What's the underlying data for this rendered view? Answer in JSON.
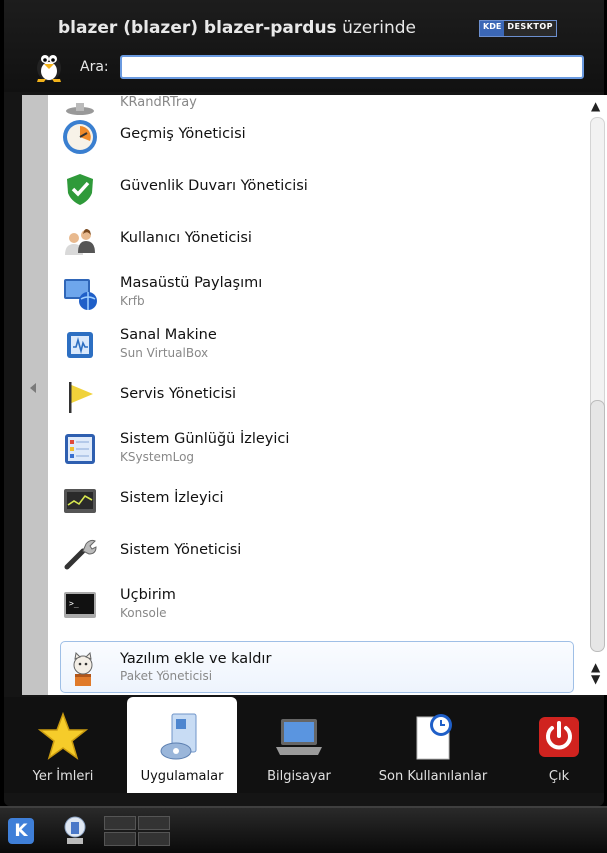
{
  "header": {
    "title_bold": "blazer (blazer) blazer-pardus",
    "title_suffix": "üzerinde",
    "badge_kde": "KDE",
    "badge_desktop": "DESKTOP"
  },
  "search": {
    "label": "Ara:",
    "value": "",
    "placeholder": ""
  },
  "apps": [
    {
      "title": "KRandRTray",
      "subtitle": "",
      "icon": "display-icon"
    },
    {
      "title": "Geçmiş Yöneticisi",
      "subtitle": "",
      "icon": "clock-icon"
    },
    {
      "title": "Güvenlik Duvarı Yöneticisi",
      "subtitle": "",
      "icon": "shield-icon"
    },
    {
      "title": "Kullanıcı Yöneticisi",
      "subtitle": "",
      "icon": "users-icon"
    },
    {
      "title": "Masaüstü Paylaşımı",
      "subtitle": "Krfb",
      "icon": "desktop-share-icon"
    },
    {
      "title": "Sanal Makine",
      "subtitle": "Sun VirtualBox",
      "icon": "virtualbox-icon"
    },
    {
      "title": "Servis Yöneticisi",
      "subtitle": "",
      "icon": "flag-icon"
    },
    {
      "title": "Sistem Günlüğü İzleyici",
      "subtitle": "KSystemLog",
      "icon": "log-icon"
    },
    {
      "title": "Sistem İzleyici",
      "subtitle": "",
      "icon": "monitor-icon"
    },
    {
      "title": "Sistem Yöneticisi",
      "subtitle": "",
      "icon": "wrench-icon"
    },
    {
      "title": "Uçbirim",
      "subtitle": "Konsole",
      "icon": "terminal-icon"
    },
    {
      "title": "Yazılım ekle ve kaldır",
      "subtitle": "Paket Yöneticisi",
      "icon": "package-cat-icon"
    }
  ],
  "tabs": [
    {
      "label": "Yer İmleri",
      "icon": "star-icon"
    },
    {
      "label": "Uygulamalar",
      "icon": "applications-icon"
    },
    {
      "label": "Bilgisayar",
      "icon": "laptop-icon"
    },
    {
      "label": "Son Kullanılanlar",
      "icon": "recent-document-icon"
    },
    {
      "label": "Çık",
      "icon": "power-icon"
    }
  ],
  "taskbar": {
    "kicker": "K"
  }
}
